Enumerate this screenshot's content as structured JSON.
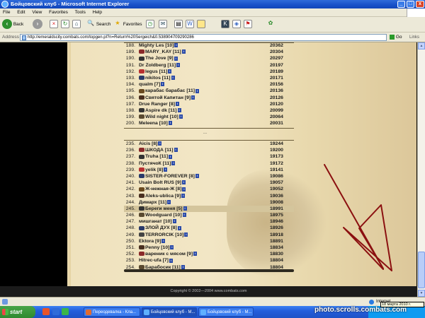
{
  "window": {
    "title": "Бойцовский клуб - Microsoft Internet Explorer"
  },
  "menu": [
    "File",
    "Edit",
    "View",
    "Favorites",
    "Tools",
    "Help"
  ],
  "toolbar": {
    "back": "Back",
    "search": "Search",
    "favorites": "Favorites"
  },
  "address": {
    "label": "Address",
    "url": "http://emeraldscity.combats.com/topgen.pl?n=Return%20Sergeich&0.538904709290286",
    "go": "Go",
    "links": "Links"
  },
  "table_top": [
    {
      "rank": "188.",
      "name": "Mighty Les [10]",
      "score": "20362"
    },
    {
      "rank": "189.",
      "name": "MARY_KAY [11]",
      "score": "20304"
    },
    {
      "rank": "190.",
      "name": "The Jove [9]",
      "score": "20297"
    },
    {
      "rank": "191.",
      "name": "Dr Zoldberg [11]",
      "score": "20197"
    },
    {
      "rank": "192.",
      "name": "legus [11]",
      "score": "20189"
    },
    {
      "rank": "193.",
      "name": "nikitos [11]",
      "score": "20171"
    },
    {
      "rank": "194.",
      "name": "qualm [7]",
      "score": "20156"
    },
    {
      "rank": "195.",
      "name": "карабас барабас [11]",
      "score": "20136"
    },
    {
      "rank": "196.",
      "name": "Святой Капитан [9]",
      "score": "20126"
    },
    {
      "rank": "197.",
      "name": "Drue Ranger [8]",
      "score": "20120"
    },
    {
      "rank": "198.",
      "name": "Aspire dk [11]",
      "score": "20099"
    },
    {
      "rank": "199.",
      "name": "Wild night [10]",
      "score": "20064"
    },
    {
      "rank": "200.",
      "name": "Meleena [10]",
      "score": "20031"
    }
  ],
  "ellipsis": "...",
  "table_bottom": [
    {
      "rank": "235.",
      "name": "Aicis [8]",
      "score": "19244"
    },
    {
      "rank": "236.",
      "name": "ШКОДА [11]",
      "score": "19200"
    },
    {
      "rank": "237.",
      "name": "Truha [11]",
      "score": "19173"
    },
    {
      "rank": "238.",
      "name": "ПустячоК [11]",
      "score": "19172"
    },
    {
      "rank": "239.",
      "name": "yelik [8]",
      "score": "19141"
    },
    {
      "rank": "240.",
      "name": "SISTER-FOREVER [8]",
      "score": "19086"
    },
    {
      "rank": "241.",
      "name": "Usain Bolt RUS [9]",
      "score": "19057"
    },
    {
      "rank": "242.",
      "name": "Ж-нежная-Ж [8]",
      "score": "19052"
    },
    {
      "rank": "243.",
      "name": "Aleks-ublica [9]",
      "score": "19036"
    },
    {
      "rank": "244.",
      "name": "Димарх [11]",
      "score": "19008"
    },
    {
      "rank": "245.",
      "name": "Береги меня [5]",
      "score": "18991"
    },
    {
      "rank": "246.",
      "name": "Woodguard [10]",
      "score": "18975"
    },
    {
      "rank": "247.",
      "name": "мишганат [10]",
      "score": "18946"
    },
    {
      "rank": "248.",
      "name": "ЗЛОЙ ДУХ [8]",
      "score": "18926"
    },
    {
      "rank": "249.",
      "name": "TERRORCIK [10]",
      "score": "18918"
    },
    {
      "rank": "250.",
      "name": "Ektora [9]",
      "score": "18891"
    },
    {
      "rank": "251.",
      "name": "Penny [10]",
      "score": "18834"
    },
    {
      "rank": "252.",
      "name": "вареник с мясом [9]",
      "score": "18830"
    },
    {
      "rank": "253.",
      "name": "Hitrec-ufa [7]",
      "score": "18804"
    },
    {
      "rank": "254.",
      "name": "Барабосик [11]",
      "score": "18804"
    }
  ],
  "footer": "Copyright © 2002—2004 www.combats.com",
  "status": {
    "zone": "Internet"
  },
  "taskbar": {
    "start": "start",
    "tasks": [
      "Переодевалка - Кла...",
      "Бойцовский клуб - M...",
      "Бойцовский клуб - M..."
    ]
  },
  "tooltip": "18 марта 2010 г.",
  "watermark": "photo.scrolls.combats.com",
  "colors": {
    "arrow": "#8b1010",
    "parchment": "#efe2bd",
    "titlebar": "#1750c8",
    "highlight": "#d4c59c"
  }
}
